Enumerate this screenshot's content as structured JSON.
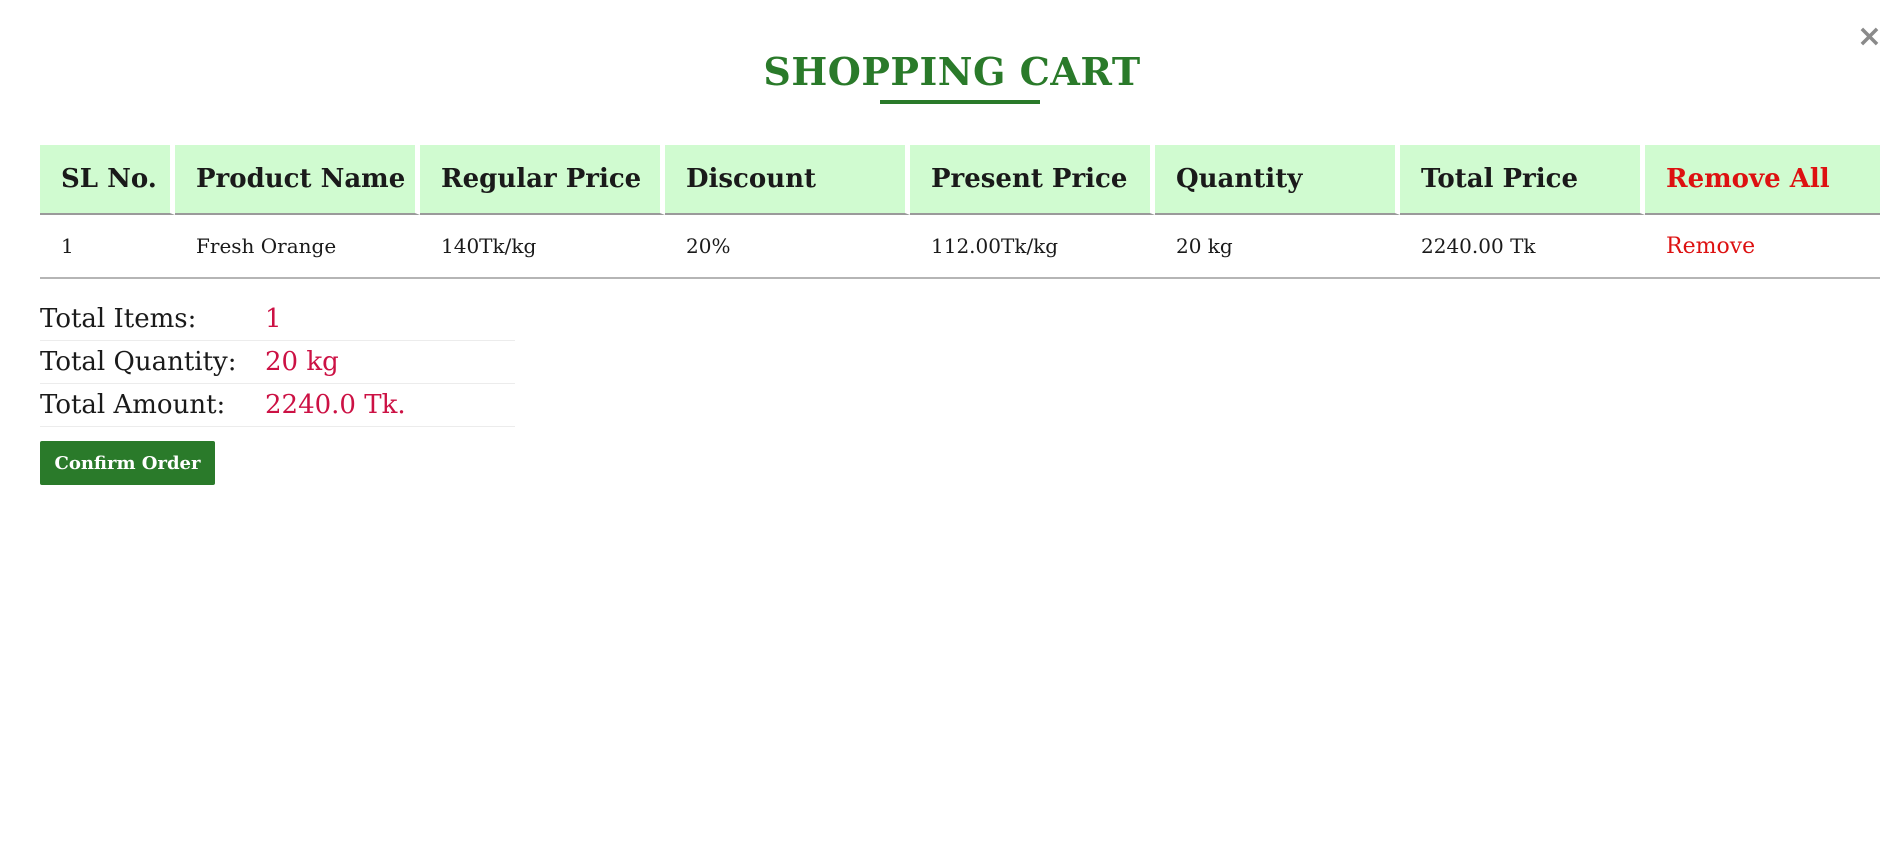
{
  "modal": {
    "title": "SHOPPING CART",
    "close_glyph": "×",
    "close_icon": "close-icon"
  },
  "table": {
    "headers": {
      "sl_no": "SL No.",
      "product_name": "Product Name",
      "regular_price": "Regular Price",
      "discount": "Discount",
      "present_price": "Present Price",
      "quantity": "Quantity",
      "total_price": "Total Price",
      "remove_all": "Remove All"
    },
    "rows": [
      {
        "sl_no": "1",
        "product_name": "Fresh Orange",
        "regular_price": "140Tk/kg",
        "discount": "20%",
        "present_price": "112.00Tk/kg",
        "quantity": "20 kg",
        "total_price": "2240.00 Tk",
        "remove": "Remove"
      }
    ]
  },
  "summary": {
    "total_items_label": "Total Items:",
    "total_items_value": "1",
    "total_quantity_label": "Total Quantity:",
    "total_quantity_value": "20 kg",
    "total_amount_label": "Total Amount:",
    "total_amount_value": "2240.0 Tk."
  },
  "actions": {
    "confirm_label": "Confirm Order"
  },
  "colors": {
    "brand_green": "#2a7a2a",
    "header_bg": "#d0fbd0",
    "remove_red": "#dd1111",
    "value_crimson": "#cc1144"
  }
}
